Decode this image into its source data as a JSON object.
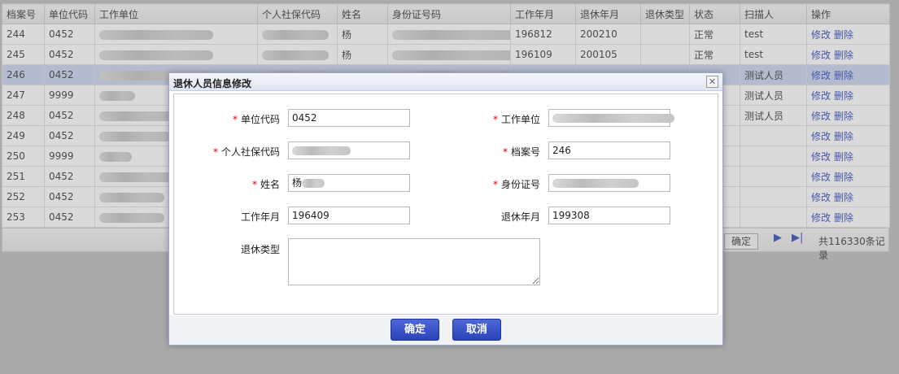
{
  "grid": {
    "columns": [
      "档案号",
      "单位代码",
      "工作单位",
      "个人社保代码",
      "姓名",
      "身份证号码",
      "工作年月",
      "退休年月",
      "退休类型",
      "状态",
      "扫描人",
      "操作"
    ],
    "rows": [
      {
        "id": "244",
        "code": "0452",
        "name": "杨",
        "work": "196812",
        "retire": "200210",
        "type": "",
        "status": "正常",
        "scanner": "test"
      },
      {
        "id": "245",
        "code": "0452",
        "name": "杨",
        "work": "196109",
        "retire": "200105",
        "type": "",
        "status": "正常",
        "scanner": "test"
      },
      {
        "id": "246",
        "code": "0452",
        "name": "",
        "work": "",
        "retire": "",
        "type": "",
        "status": "",
        "scanner": "测试人员"
      },
      {
        "id": "247",
        "code": "9999",
        "name": "",
        "work": "",
        "retire": "",
        "type": "",
        "status": "",
        "scanner": "测试人员"
      },
      {
        "id": "248",
        "code": "0452",
        "name": "",
        "work": "",
        "retire": "",
        "type": "",
        "status": "",
        "scanner": "测试人员"
      },
      {
        "id": "249",
        "code": "0452",
        "name": "",
        "work": "",
        "retire": "",
        "type": "",
        "status": "",
        "scanner": ""
      },
      {
        "id": "250",
        "code": "9999",
        "name": "",
        "work": "",
        "retire": "",
        "type": "",
        "status": "",
        "scanner": ""
      },
      {
        "id": "251",
        "code": "0452",
        "name": "",
        "work": "",
        "retire": "",
        "type": "",
        "status": "",
        "scanner": ""
      },
      {
        "id": "252",
        "code": "0452",
        "name": "",
        "work": "",
        "retire": "",
        "type": "",
        "status": "",
        "scanner": ""
      },
      {
        "id": "253",
        "code": "0452",
        "name": "",
        "work": "",
        "retire": "",
        "type": "",
        "status": "",
        "scanner": ""
      }
    ],
    "action_edit": "修改",
    "action_delete": "删除"
  },
  "pager": {
    "ok_label": "确定",
    "total_label": "共116330条记录"
  },
  "dialog": {
    "title": "退休人员信息修改",
    "close_glyph": "✕",
    "fields": {
      "unit_code": {
        "label": "单位代码",
        "value": "0452"
      },
      "work_unit": {
        "label": "工作单位",
        "value": ""
      },
      "social_code": {
        "label": "个人社保代码",
        "value": ""
      },
      "file_no": {
        "label": "档案号",
        "value": "246"
      },
      "name": {
        "label": "姓名",
        "value": "杨"
      },
      "id_no": {
        "label": "身份证号",
        "value": ""
      },
      "work_month": {
        "label": "工作年月",
        "value": "196409"
      },
      "retire_month": {
        "label": "退休年月",
        "value": "199308"
      },
      "retire_type": {
        "label": "退休类型",
        "value": ""
      }
    },
    "required_mark": "*",
    "confirm_label": "确定",
    "cancel_label": "取消"
  }
}
